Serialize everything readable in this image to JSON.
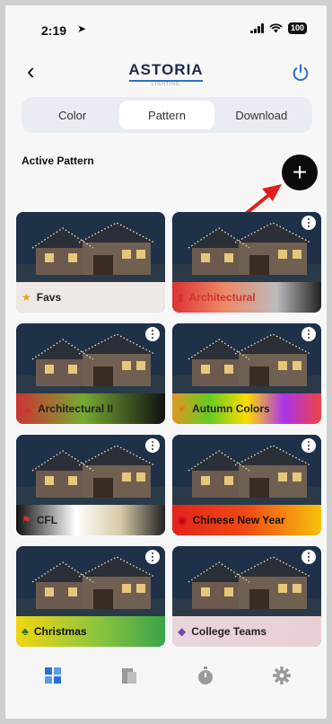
{
  "status": {
    "time": "2:19",
    "battery": "100"
  },
  "header": {
    "brand": "ASTORIA",
    "brand_sub": "LIGHTING"
  },
  "tabs": [
    {
      "label": "Color",
      "active": false
    },
    {
      "label": "Pattern",
      "active": true
    },
    {
      "label": "Download",
      "active": false
    }
  ],
  "section": {
    "title": "Active Pattern"
  },
  "patterns": [
    {
      "label": "Favs",
      "icon": "star-icon",
      "bg": "linear-gradient(90deg,#efe9e6,#efe9e6)",
      "label_color": "#222"
    },
    {
      "label": "Architectural",
      "icon": "bar-chart-icon",
      "bg": "linear-gradient(90deg,#d33 0%,#e86 35%,#bbb 70%,#222 100%)",
      "label_color": "#c33"
    },
    {
      "label": "Architectural II",
      "icon": "cloud-icon",
      "bg": "linear-gradient(90deg,#c33 0%,#7a3 45%,#111 100%)",
      "label_color": "#222"
    },
    {
      "label": "Autumn Colors",
      "icon": "leaf-icon",
      "bg": "linear-gradient(90deg,#d92 0%,#6c2 25%,#fd0 50%,#a3e 75%,#e44 100%)",
      "label_color": "#222"
    },
    {
      "label": "CFL",
      "icon": "flag-icon",
      "bg": "linear-gradient(90deg,#111 0%,#fff 40%,#d8c9a8 70%,#222 100%)",
      "label_color": "#222"
    },
    {
      "label": "Chinese New Year",
      "icon": "lantern-icon",
      "bg": "linear-gradient(90deg,#e2231a 0%,#f04a14 50%,#f7c20c 100%)",
      "label_color": "#111"
    },
    {
      "label": "Christmas",
      "icon": "tree-icon",
      "bg": "linear-gradient(90deg,#f2d60f 0%,#8bc53f 55%,#3aa34a 100%)",
      "label_color": "#111"
    },
    {
      "label": "College Teams",
      "icon": "graduation-icon",
      "bg": "linear-gradient(90deg,#e9d6db 0%,#e9cfd3 100%)",
      "label_color": "#222"
    }
  ],
  "bottom_nav": [
    {
      "name": "home-tab-icon",
      "active": true
    },
    {
      "name": "scenes-tab-icon",
      "active": false
    },
    {
      "name": "timer-tab-icon",
      "active": false
    },
    {
      "name": "settings-tab-icon",
      "active": false
    }
  ]
}
